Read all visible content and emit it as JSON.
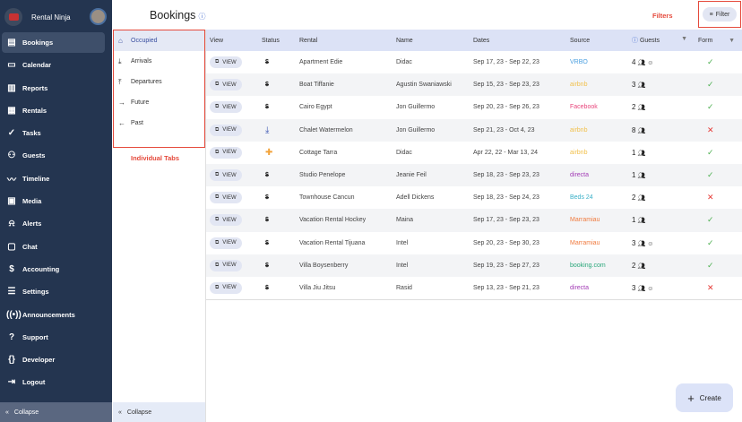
{
  "app": {
    "name": "Rental Ninja"
  },
  "sidebar": {
    "items": [
      {
        "label": "Bookings",
        "icon": "bookings-icon",
        "g": "▤"
      },
      {
        "label": "Calendar",
        "icon": "calendar-icon",
        "g": "▭"
      },
      {
        "label": "Reports",
        "icon": "bar-chart-icon",
        "g": "▥"
      },
      {
        "label": "Rentals",
        "icon": "buildings-icon",
        "g": "▦"
      },
      {
        "label": "Tasks",
        "icon": "check-circle-icon",
        "g": "✓"
      },
      {
        "label": "Guests",
        "icon": "people-icon",
        "g": "⚇"
      },
      {
        "label": "Timeline",
        "icon": "timeline-icon",
        "g": "〰"
      },
      {
        "label": "Media",
        "icon": "image-icon",
        "g": "▣"
      },
      {
        "label": "Alerts",
        "icon": "bell-icon",
        "g": "⍾"
      },
      {
        "label": "Chat",
        "icon": "chat-icon",
        "g": "▢"
      },
      {
        "label": "Accounting",
        "icon": "accounting-icon",
        "g": "$"
      },
      {
        "label": "Settings",
        "icon": "sliders-icon",
        "g": "☰"
      },
      {
        "label": "Announcements",
        "icon": "broadcast-icon",
        "g": "((•))"
      },
      {
        "label": "Support",
        "icon": "help-icon",
        "g": "?"
      },
      {
        "label": "Developer",
        "icon": "code-icon",
        "g": "{}"
      },
      {
        "label": "Logout",
        "icon": "logout-icon",
        "g": "⇥"
      }
    ],
    "collapse": "Collapse"
  },
  "tabs": {
    "items": [
      {
        "label": "Occupied",
        "g": "⌂"
      },
      {
        "label": "Arrivals",
        "g": "⤓"
      },
      {
        "label": "Departures",
        "g": "⤒"
      },
      {
        "label": "Future",
        "g": "→"
      },
      {
        "label": "Past",
        "g": "←"
      }
    ],
    "collapse": "Collapse"
  },
  "annotations": {
    "tabs": "Individual Tabs",
    "filters": "Filters"
  },
  "header": {
    "title": "Bookings",
    "filter": "Filter"
  },
  "table": {
    "columns": [
      "View",
      "Status",
      "Rental",
      "Name",
      "Dates",
      "Source",
      "Guests",
      "Form"
    ],
    "view_label": "VIEW",
    "rows": [
      {
        "status": "money-off",
        "rental": "Apartment Edie",
        "name": "Didac",
        "dates": "Sep 17, 23 - Sep 22, 23",
        "source": "VRBO",
        "guests": "4",
        "child": true,
        "form": true
      },
      {
        "status": "money-off",
        "rental": "Boat Tiffanie",
        "name": "Agustin Swaniawski",
        "dates": "Sep 15, 23 - Sep 23, 23",
        "source": "airbnb",
        "guests": "3",
        "child": false,
        "form": true
      },
      {
        "status": "money-off",
        "rental": "Cairo Egypt",
        "name": "Jon Guillermo",
        "dates": "Sep 20, 23 - Sep 26, 23",
        "source": "Facebook",
        "guests": "2",
        "child": false,
        "form": true
      },
      {
        "status": "arrival",
        "rental": "Chalet Watermelon",
        "name": "Jon Guillermo",
        "dates": "Sep 21, 23 - Oct 4, 23",
        "source": "airbnb",
        "guests": "8",
        "child": false,
        "form": false
      },
      {
        "status": "bandage",
        "rental": "Cottage Tarra",
        "name": "Didac",
        "dates": "Apr 22, 22 - Mar 13, 24",
        "source": "airbnb",
        "guests": "1",
        "child": false,
        "form": true
      },
      {
        "status": "money-off",
        "rental": "Studio Penelope",
        "name": "Jeanie Feil",
        "dates": "Sep 18, 23 - Sep 23, 23",
        "source": "directa",
        "guests": "1",
        "child": false,
        "form": true
      },
      {
        "status": "money-off",
        "rental": "Townhouse Cancun",
        "name": "Adell Dickens",
        "dates": "Sep 18, 23 - Sep 24, 23",
        "source": "Beds 24",
        "guests": "2",
        "child": false,
        "form": false
      },
      {
        "status": "money-off",
        "rental": "Vacation Rental Hockey",
        "name": "Maina",
        "dates": "Sep 17, 23 - Sep 23, 23",
        "source": "Marramiau",
        "guests": "1",
        "child": false,
        "form": true
      },
      {
        "status": "money-off",
        "rental": "Vacation Rental Tijuana",
        "name": "Intel",
        "dates": "Sep 20, 23 - Sep 30, 23",
        "source": "Marramiau",
        "guests": "3",
        "child": true,
        "form": true
      },
      {
        "status": "money-off",
        "rental": "Villa Boysenberry",
        "name": "Intel",
        "dates": "Sep 19, 23 - Sep 27, 23",
        "source": "booking.com",
        "guests": "2",
        "child": false,
        "form": true
      },
      {
        "status": "money-off",
        "rental": "Villa Jiu Jitsu",
        "name": "Rasid",
        "dates": "Sep 13, 23 - Sep 21, 23",
        "source": "directa",
        "guests": "3",
        "child": true,
        "form": false
      }
    ]
  },
  "source_colors": {
    "VRBO": "#4a9fe0",
    "airbnb": "#f2c14e",
    "Facebook": "#e8467c",
    "directa": "#a23bb5",
    "Beds 24": "#3ab0c8",
    "Marramiau": "#f07b3f",
    "booking.com": "#2aa77a"
  },
  "create": "Create"
}
